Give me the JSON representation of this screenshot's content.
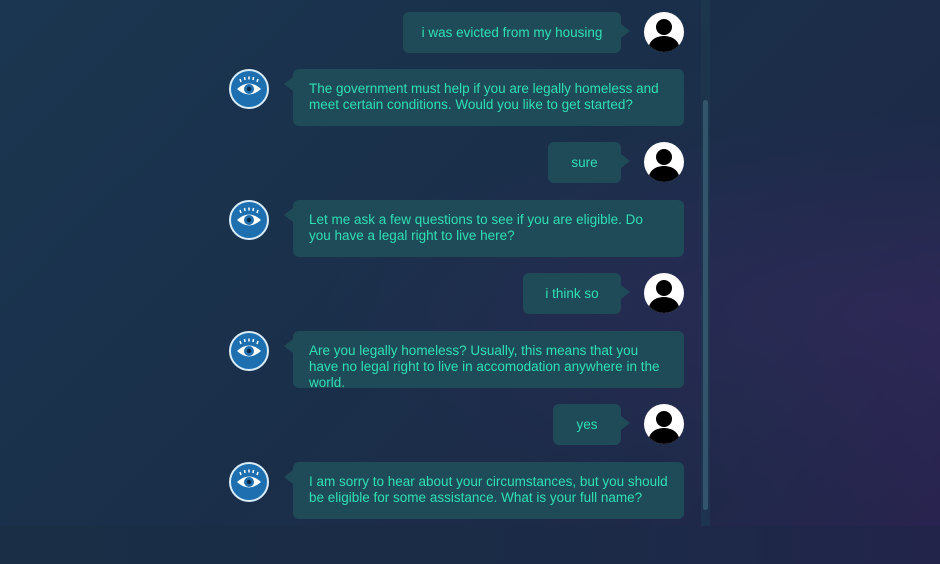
{
  "conversation": {
    "messages": [
      {
        "sender": "user",
        "text": "i was evicted from my housing",
        "avatar": "person-silhouette-icon"
      },
      {
        "sender": "bot",
        "text": "The government must help if you are legally homeless and meet certain conditions. Would you like to get started?",
        "avatar": "eye-icon"
      },
      {
        "sender": "user",
        "text": "sure",
        "avatar": "person-silhouette-icon"
      },
      {
        "sender": "bot",
        "text": "Let me ask a few questions to see if you are eligible. Do you have a legal right to live here?",
        "avatar": "eye-icon"
      },
      {
        "sender": "user",
        "text": "i think so",
        "avatar": "person-silhouette-icon"
      },
      {
        "sender": "bot",
        "text": "Are you legally homeless? Usually, this means that you have no legal right to live in accomodation anywhere in the world.",
        "avatar": "eye-icon"
      },
      {
        "sender": "user",
        "text": "yes",
        "avatar": "person-silhouette-icon"
      },
      {
        "sender": "bot",
        "text": "I am sorry to hear about your circumstances, but you should be eligible for some assistance. What is your full name?",
        "avatar": "eye-icon"
      }
    ]
  },
  "colors": {
    "background": "#1b3650",
    "bubble": "#1f4a58",
    "text": "#2fe0b4",
    "bot_avatar": "#1e6fb0"
  }
}
